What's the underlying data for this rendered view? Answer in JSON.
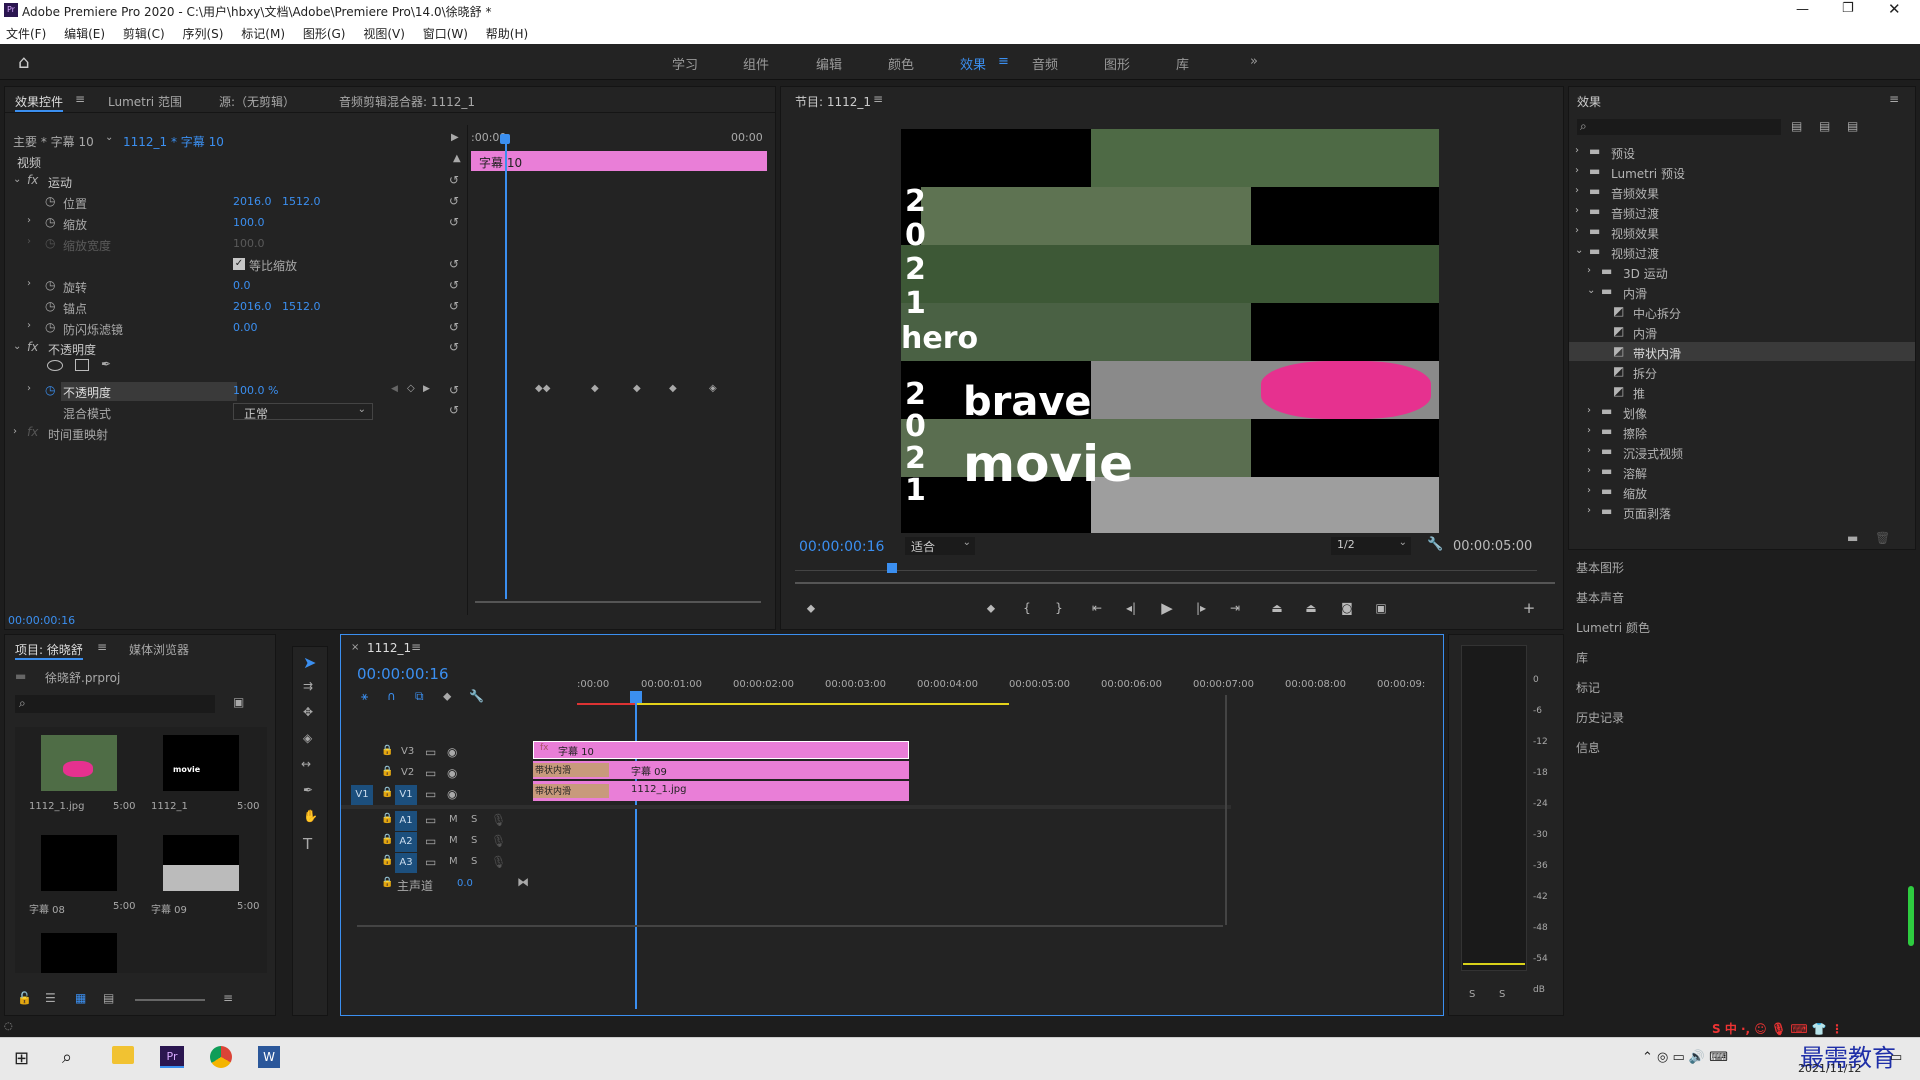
{
  "window": {
    "title": "Adobe Premiere Pro 2020 - C:\\用户\\hbxy\\文档\\Adobe\\Premiere Pro\\14.0\\徐晓舒 *"
  },
  "menu": [
    "文件(F)",
    "编辑(E)",
    "剪辑(C)",
    "序列(S)",
    "标记(M)",
    "图形(G)",
    "视图(V)",
    "窗口(W)",
    "帮助(H)"
  ],
  "workspaces": [
    "学习",
    "组件",
    "编辑",
    "颜色",
    "效果",
    "音频",
    "图形",
    "库"
  ],
  "workspace_active": "效果",
  "effect_controls": {
    "tabs": [
      "效果控件",
      "Lumetri 范围",
      "源:（无剪辑）",
      "音频剪辑混合器: 1112_1"
    ],
    "clip_master": "主要 * 字幕 10",
    "clip_seq": "1112_1 * 字幕 10",
    "time_start": ":00:00",
    "time_end": "00:00",
    "clip_name": "字幕 10",
    "section_video": "视频",
    "motion": "运动",
    "position_label": "位置",
    "position_x": "2016.0",
    "position_y": "1512.0",
    "scale_label": "缩放",
    "scale": "100.0",
    "scale_width_label": "缩放宽度",
    "scale_width": "100.0",
    "uniform_label": "等比缩放",
    "rotation_label": "旋转",
    "rotation": "0.0",
    "anchor_label": "锚点",
    "anchor_x": "2016.0",
    "anchor_y": "1512.0",
    "flicker_label": "防闪烁滤镜",
    "flicker": "0.00",
    "opacity_section": "不透明度",
    "opacity_label": "不透明度",
    "opacity": "100.0 %",
    "blend_label": "混合模式",
    "blend": "正常",
    "time_remap": "时间重映射",
    "current_time": "00:00:00:16"
  },
  "program": {
    "title": "节目: 1112_1",
    "timecode": "00:00:00:16",
    "fit": "适合",
    "quality": "1/2",
    "duration": "00:00:05:00",
    "text_year_top": [
      "2",
      "0",
      "2",
      "1"
    ],
    "text_hero": "hero",
    "text_year_bottom": [
      "2",
      "0",
      "2",
      "1"
    ],
    "text_brave": "brave",
    "text_movie": "movie"
  },
  "project": {
    "tabs": [
      "项目: 徐晓舒",
      "媒体浏览器"
    ],
    "file": "徐晓舒.prproj",
    "items": [
      {
        "name": "1112_1.jpg",
        "dur": "5:00"
      },
      {
        "name": "1112_1",
        "dur": "5:00"
      },
      {
        "name": "字幕 08",
        "dur": "5:00"
      },
      {
        "name": "字幕 09",
        "dur": "5:00"
      }
    ]
  },
  "timeline": {
    "tab": "1112_1",
    "timecode": "00:00:00:16",
    "ruler": [
      ":00:00",
      "00:00:01:00",
      "00:00:02:00",
      "00:00:03:00",
      "00:00:04:00",
      "00:00:05:00",
      "00:00:06:00",
      "00:00:07:00",
      "00:00:08:00",
      "00:00:09:"
    ],
    "video_tracks": [
      "V3",
      "V2",
      "V1"
    ],
    "audio_tracks": [
      "A1",
      "A2",
      "A3"
    ],
    "source_patch": "V1",
    "master_label": "主声道",
    "master_value": "0.0",
    "clip_v3": "字幕 10",
    "clip_v2": "字幕 09",
    "clip_v1": "1112_1.jpg",
    "transition": "带状内滑"
  },
  "effects": {
    "title": "效果",
    "tree": [
      "预设",
      "Lumetri 预设",
      "音频效果",
      "音频过渡",
      "视频效果",
      "视频过渡",
      "3D 运动",
      "内滑",
      "中心拆分",
      "内滑",
      "带状内滑",
      "拆分",
      "推",
      "划像",
      "擦除",
      "沉浸式视频",
      "溶解",
      "缩放",
      "页面剥落"
    ],
    "selected": "带状内滑"
  },
  "side_panels": [
    "基本图形",
    "基本声音",
    "Lumetri 颜色",
    "库",
    "标记",
    "历史记录",
    "信息"
  ],
  "meter_scale": [
    "0",
    "-6",
    "-12",
    "-18",
    "-24",
    "-30",
    "-36",
    "-42",
    "-48",
    "-54",
    "dB"
  ],
  "meter_buttons": [
    "S",
    "S"
  ],
  "track_buttons": {
    "mute": "M",
    "solo": "S"
  },
  "taskbar": {
    "date": "2021/11/12",
    "watermark": "最需教育"
  }
}
